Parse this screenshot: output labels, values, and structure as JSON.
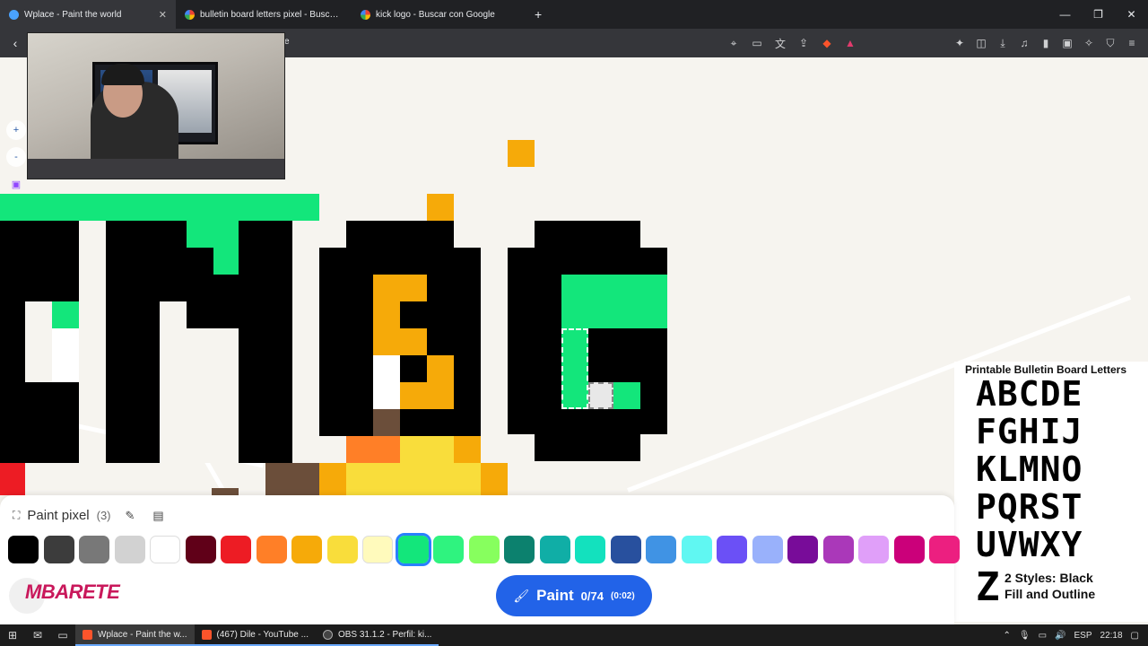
{
  "browser": {
    "tabs": [
      {
        "label": "Wplace - Paint the world",
        "active": true
      },
      {
        "label": "bulletin board letters pixel - Buscar c",
        "active": false
      },
      {
        "label": "kick logo - Buscar con Google",
        "active": false
      }
    ],
    "new_tab": "+",
    "url_fragment": "ve",
    "window_controls": {
      "minimize": "—",
      "maximize": "❐",
      "close": "✕"
    },
    "back": "‹"
  },
  "map": {
    "zoom_in": "+",
    "zoom_out": "-"
  },
  "overlay": {
    "title": "Printable Bulletin Board Letters",
    "rows": [
      "ABCDE",
      "FGHIJ",
      "KLMNO",
      "PQRST",
      "UVWXY"
    ],
    "last_letter": "Z",
    "styles_line1": "2 Styles: Black",
    "styles_line2": "Fill and Outline"
  },
  "paint_panel": {
    "title": "Paint pixel",
    "count": "(3)",
    "colors": [
      "#000000",
      "#3c3c3c",
      "#787878",
      "#d2d2d2",
      "#ffffff",
      "#600018",
      "#ed1c24",
      "#ff7f27",
      "#f6aa09",
      "#f9dd3b",
      "#fffabc",
      "#13e67b",
      "#2ff37f",
      "#87ff5e",
      "#0c816e",
      "#10aea6",
      "#13e1be",
      "#28509e",
      "#4093e4",
      "#60f7f2",
      "#6b50f6",
      "#99b1fb",
      "#780c99",
      "#aa38b9",
      "#e09ff9",
      "#cb007a",
      "#ec1f80"
    ],
    "selected_color": "#13e67b",
    "logo_text": "MBARETE",
    "paint_button": {
      "label": "Paint",
      "count": "0/74",
      "time": "(0:02)"
    }
  },
  "taskbar": {
    "items": [
      {
        "label": "Wplace - Paint the w...",
        "active": true
      },
      {
        "label": "(467) Dile - YouTube ...",
        "active": false
      },
      {
        "label": "OBS 31.1.2 - Perfil: ki...",
        "active": false
      }
    ],
    "tray": {
      "lang": "ESP",
      "time": "22:18"
    }
  }
}
